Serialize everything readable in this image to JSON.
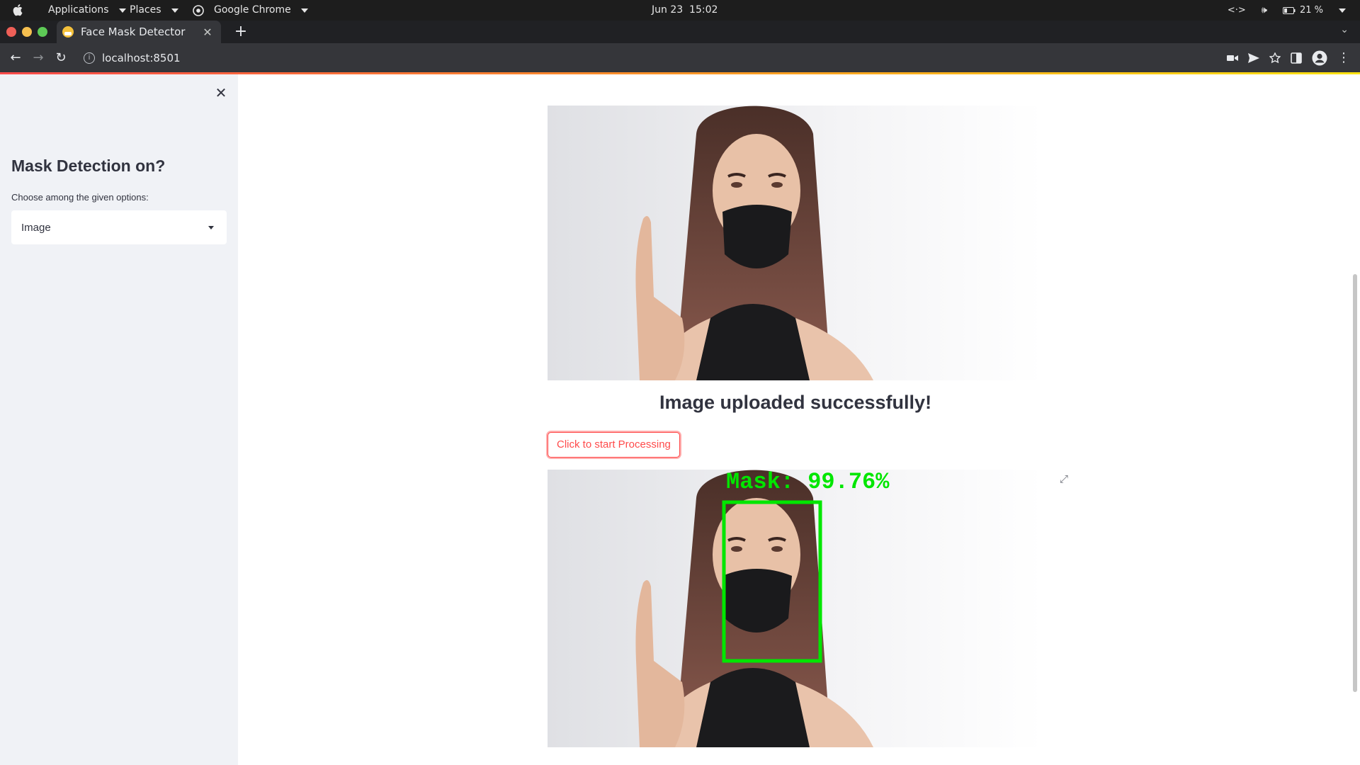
{
  "topbar": {
    "menus": [
      "Applications",
      "Places",
      "Google Chrome"
    ],
    "clock": "Jun 23  15:02",
    "battery": "21 %"
  },
  "browser": {
    "tab_title": "Face Mask Detector",
    "new_tab": "+",
    "url": "localhost:8501"
  },
  "sidebar": {
    "title": "Mask Detection on?",
    "select_label": "Choose among the given options:",
    "select_value": "Image"
  },
  "main": {
    "success_message": "Image uploaded successfully!",
    "process_button": "Click to start Processing",
    "detection_label": "Mask: 99.76%"
  },
  "colors": {
    "accent": "#ff4b4b",
    "sidebar_bg": "#f0f2f6",
    "detection_box": "#00e600"
  },
  "icons": [
    "apple-icon",
    "chrome-icon",
    "close-tab-icon",
    "back-icon",
    "forward-icon",
    "reload-icon",
    "info-icon",
    "camera-icon",
    "send-icon",
    "star-icon",
    "sidebar-toggle-icon",
    "profile-icon",
    "kebab-menu-icon",
    "close-sidebar-icon",
    "fullscreen-icon",
    "dropdown-arrow-icon"
  ]
}
